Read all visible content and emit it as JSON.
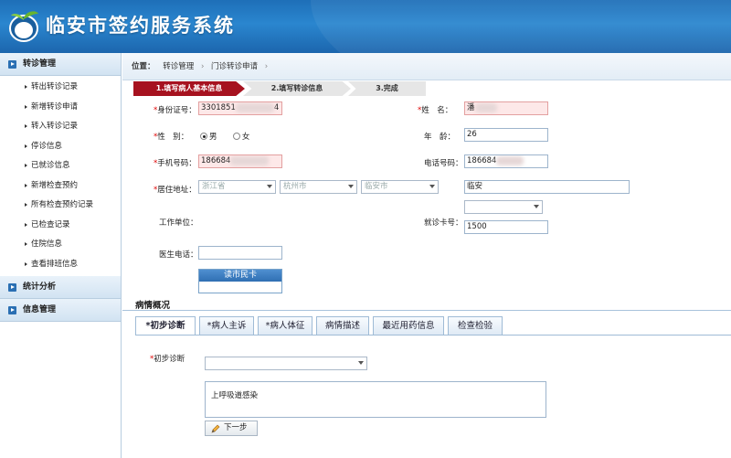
{
  "header": {
    "title": "临安市签约服务系统"
  },
  "sidebar": {
    "groups": [
      {
        "label": "转诊管理"
      },
      {
        "label": "统计分析"
      },
      {
        "label": "信息管理"
      }
    ],
    "items": [
      "转出转诊记录",
      "新增转诊申请",
      "转入转诊记录",
      "停诊信息",
      "已就诊信息",
      "新增检查预约",
      "所有检查预约记录",
      "已检查记录",
      "住院信息",
      "查看排班信息"
    ]
  },
  "breadcrumb": {
    "prefix": "位置：",
    "items": [
      "转诊管理",
      "门诊转诊申请"
    ],
    "sep": "›"
  },
  "steps": [
    "1.填写病人基本信息",
    "2.填写转诊信息",
    "3.完成"
  ],
  "form": {
    "req_mark": "*",
    "id_label": "身份证号：",
    "id_value": "3301851",
    "id_tail": "4",
    "name_label": "姓　名：",
    "name_value": "潘",
    "gender_label": "性　别：",
    "gender_male": "男",
    "gender_female": "女",
    "age_label": "年　龄：",
    "age_value": "26",
    "phone_label": "手机号码：",
    "phone_value": "186684",
    "tel_label": "电话号码：",
    "tel_value": "186684",
    "address_label": "居住地址：",
    "province": "浙江省",
    "city": "杭州市",
    "county": "临安市",
    "address_detail": "临安",
    "work_label": "工作单位：",
    "card_label": "就诊卡号：",
    "card_value": "1500",
    "doctor_phone_label": "医生电话：",
    "read_card_button": "读市民卡"
  },
  "condition": {
    "section_title": "病情概况",
    "tabs": [
      "*初步诊断",
      "*病人主诉",
      "*病人体征",
      "病情描述",
      "最近用药信息",
      "检查检验"
    ],
    "diagnosis_label": "初步诊断",
    "diagnosis_text": "上呼吸道感染",
    "next_button": "下一步"
  }
}
